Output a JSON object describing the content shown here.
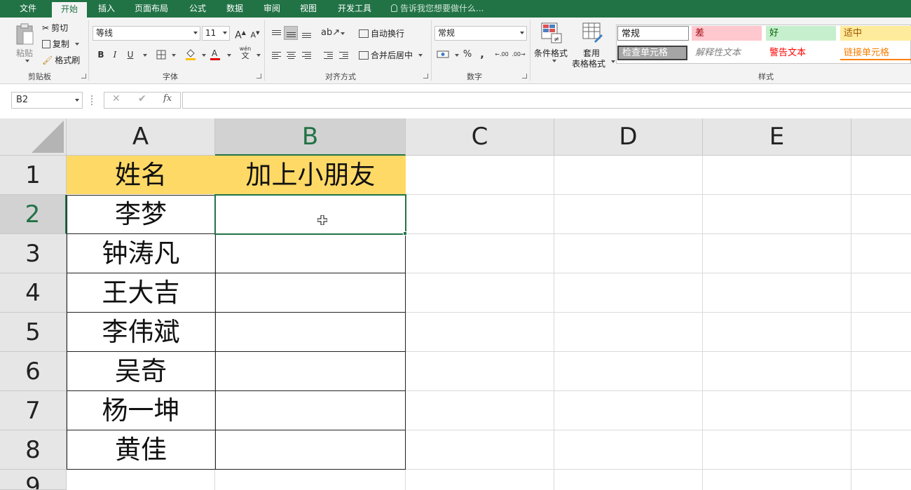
{
  "tabs": [
    "文件",
    "开始",
    "插入",
    "页面布局",
    "公式",
    "数据",
    "审阅",
    "视图",
    "开发工具"
  ],
  "active_tab": "开始",
  "tell_me": "告诉我您想要做什么...",
  "ribbon": {
    "clipboard": {
      "paste": "粘贴",
      "cut": "剪切",
      "copy": "复制",
      "format_painter": "格式刷",
      "label": "剪贴板"
    },
    "font": {
      "name": "等线",
      "size": "11",
      "grow": "A",
      "shrink": "A",
      "bold": "B",
      "italic": "I",
      "underline": "U",
      "label": "字体",
      "wen": "wén",
      "wen_char": "文"
    },
    "alignment": {
      "wrap_text": "自动换行",
      "merge_center": "合并后居中",
      "label": "对齐方式"
    },
    "number": {
      "format": "常规",
      "percent": "%",
      "comma": ",",
      "inc_decimal": ".00",
      "dec_decimal": ".00",
      "label": "数字"
    },
    "styles": {
      "conditional": "条件格式",
      "table_format_1": "套用",
      "table_format_2": "表格格式",
      "gallery": [
        "常规",
        "差",
        "好",
        "适中",
        "检查单元格",
        "解释性文本",
        "警告文本",
        "链接单元格"
      ],
      "label": "样式"
    }
  },
  "name_box": "B2",
  "formula_icons": {
    "cancel": "✕",
    "enter": "✔",
    "fx": "fx"
  },
  "formula_value": "",
  "columns": [
    "A",
    "B",
    "C",
    "D",
    "E"
  ],
  "rows": [
    "1",
    "2",
    "3",
    "4",
    "5",
    "6",
    "7",
    "8",
    "9"
  ],
  "cells": {
    "A1": "姓名",
    "B1": "加上小朋友",
    "A2": "李梦",
    "A3": "钟涛凡",
    "A4": "王大吉",
    "A5": "李伟斌",
    "A6": "吴奇",
    "A7": "杨一坤",
    "A8": "黄佳"
  },
  "colors": {
    "excel_green": "#217346",
    "header_fill": "#ffd966"
  }
}
